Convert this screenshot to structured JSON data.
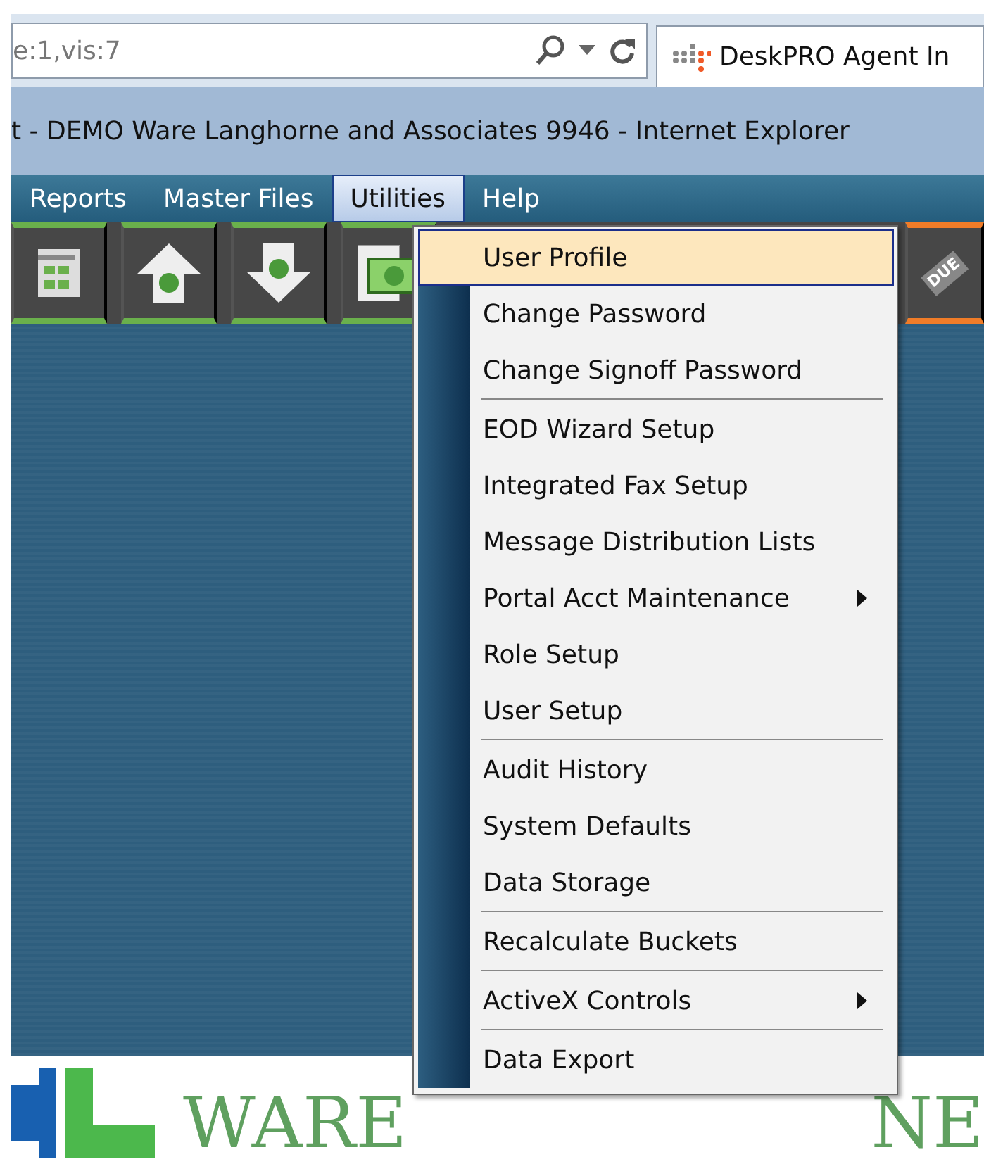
{
  "address_bar": {
    "value": "e:1,vis:7"
  },
  "browser_tab": {
    "title": "DeskPRO Agent In"
  },
  "window_title": "t - DEMO Ware Langhorne and Associates 9946 - Internet Explorer",
  "menu_bar": [
    {
      "label": "Reports",
      "selected": false
    },
    {
      "label": "Master Files",
      "selected": false
    },
    {
      "label": "Utilities",
      "selected": true
    },
    {
      "label": "Help",
      "selected": false
    }
  ],
  "toolbar": [
    {
      "kind": "sheet"
    },
    {
      "kind": "up"
    },
    {
      "kind": "down"
    },
    {
      "kind": "bill"
    }
  ],
  "toolbar_due": {
    "label": "DUE"
  },
  "dropdown": [
    [
      {
        "label": "User Profile",
        "selected": true,
        "submenu": false
      },
      {
        "label": "Change Password",
        "selected": false,
        "submenu": false
      },
      {
        "label": "Change Signoff Password",
        "selected": false,
        "submenu": false
      }
    ],
    [
      {
        "label": "EOD Wizard Setup",
        "selected": false,
        "submenu": false
      },
      {
        "label": "Integrated Fax Setup",
        "selected": false,
        "submenu": false
      },
      {
        "label": "Message Distribution Lists",
        "selected": false,
        "submenu": false
      },
      {
        "label": "Portal Acct Maintenance",
        "selected": false,
        "submenu": true
      },
      {
        "label": "Role Setup",
        "selected": false,
        "submenu": false
      },
      {
        "label": "User Setup",
        "selected": false,
        "submenu": false
      }
    ],
    [
      {
        "label": "Audit History",
        "selected": false,
        "submenu": false
      },
      {
        "label": "System Defaults",
        "selected": false,
        "submenu": false
      },
      {
        "label": "Data Storage",
        "selected": false,
        "submenu": false
      }
    ],
    [
      {
        "label": "Recalculate Buckets",
        "selected": false,
        "submenu": false
      }
    ],
    [
      {
        "label": "ActiveX Controls",
        "selected": false,
        "submenu": true
      }
    ],
    [
      {
        "label": "Data Export",
        "selected": false,
        "submenu": false
      }
    ]
  ],
  "logo": {
    "texts": [
      "WARE",
      "NE"
    ]
  }
}
